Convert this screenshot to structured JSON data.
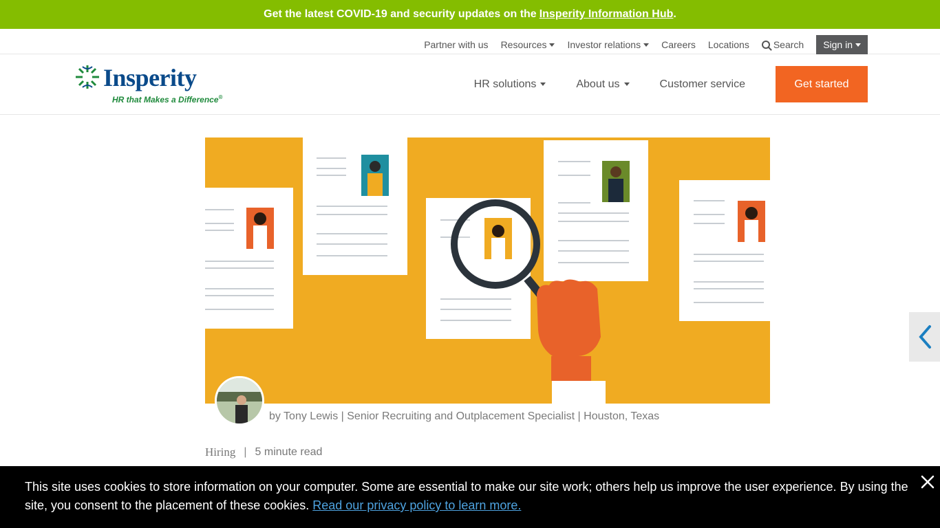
{
  "alert": {
    "text": "Get the latest COVID-19 and security updates on the",
    "link": "Insperity Information Hub",
    "suffix": "."
  },
  "utility_nav": {
    "partner": "Partner with us",
    "resources": "Resources",
    "investor": "Investor relations",
    "careers": "Careers",
    "locations": "Locations",
    "search": "Search",
    "signin": "Sign in"
  },
  "brand": {
    "name": "Insperity",
    "tagline": "HR that Makes a Difference",
    "mark": "®"
  },
  "main_nav": {
    "hr_solutions": "HR solutions",
    "about": "About us",
    "customer_service": "Customer service",
    "get_started": "Get started"
  },
  "article": {
    "byline": "by Tony Lewis | Senior Recruiting and Outplacement Specialist | Houston, Texas",
    "category": "Hiring",
    "separator": "|",
    "read_time": "5 minute read"
  },
  "cookie": {
    "text": "This site uses cookies to store information on your computer. Some are essential to make our site work; others help us improve the user experience. By using the site, you consent to the placement of these cookies.",
    "link": "Read our privacy policy to learn more."
  },
  "colors": {
    "alert_green": "#84bd00",
    "cta_orange": "#f26522",
    "hero_yellow": "#f0ab22",
    "brand_blue": "#0a4a8a",
    "brand_green": "#1f8a3c"
  }
}
